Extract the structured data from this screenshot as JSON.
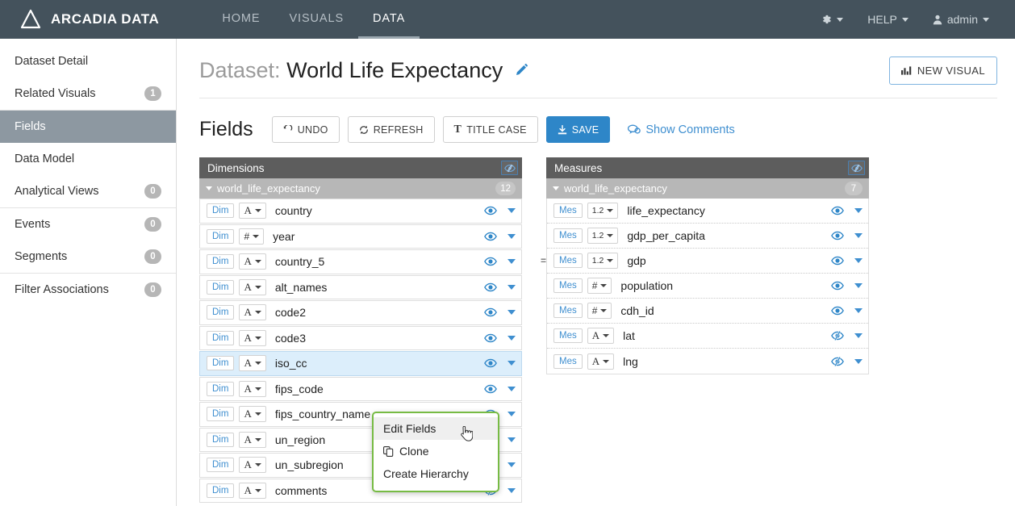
{
  "topnav": {
    "brand": "ARCADIA DATA",
    "logo_icon": "triangle-logo-icon",
    "links": [
      {
        "label": "HOME",
        "name": "nav-link-home",
        "active": false
      },
      {
        "label": "VISUALS",
        "name": "nav-link-visuals",
        "active": false
      },
      {
        "label": "DATA",
        "name": "nav-link-data",
        "active": true
      }
    ],
    "settings_icon": "gear-icon",
    "help_label": "HELP",
    "user_label": "admin",
    "user_icon": "user-icon"
  },
  "sidebar": {
    "groups": [
      {
        "items": [
          {
            "label": "Dataset Detail",
            "count": null,
            "active": false
          },
          {
            "label": "Related Visuals",
            "count": "1",
            "active": false
          }
        ]
      },
      {
        "items": [
          {
            "label": "Fields",
            "count": null,
            "active": true
          },
          {
            "label": "Data Model",
            "count": null,
            "active": false
          },
          {
            "label": "Analytical Views",
            "count": "0",
            "active": false
          }
        ]
      },
      {
        "items": [
          {
            "label": "Events",
            "count": "0",
            "active": false
          },
          {
            "label": "Segments",
            "count": "0",
            "active": false
          }
        ]
      },
      {
        "items": [
          {
            "label": "Filter Associations",
            "count": "0",
            "active": false
          }
        ]
      }
    ]
  },
  "page": {
    "title_prefix": "Dataset:",
    "title_name": "World Life Expectancy",
    "edit_icon": "pencil-icon",
    "new_visual_label": "NEW VISUAL",
    "new_visual_icon": "bar-chart-icon"
  },
  "toolbar": {
    "title": "Fields",
    "undo_label": "UNDO",
    "undo_icon": "undo-arrow-icon",
    "refresh_label": "REFRESH",
    "refresh_icon": "refresh-icon",
    "titlecase_label": "TITLE CASE",
    "titlecase_icon": "text-T-icon",
    "save_label": "SAVE",
    "save_icon": "download-save-icon",
    "comments_label": "Show Comments",
    "comments_icon": "speech-bubble-icon"
  },
  "dimensions_panel": {
    "header": "Dimensions",
    "header_eye_icon": "eye-slash-icon",
    "group_name": "world_life_expectancy",
    "group_count": "12",
    "fields": [
      {
        "tag": "Dim",
        "type": "A",
        "name": "country",
        "visible": true,
        "selected": false,
        "calculated": false
      },
      {
        "tag": "Dim",
        "type": "#",
        "name": "year",
        "visible": true,
        "selected": false,
        "calculated": false
      },
      {
        "tag": "Dim",
        "type": "A",
        "name": "country_5",
        "visible": true,
        "selected": false,
        "calculated": false
      },
      {
        "tag": "Dim",
        "type": "A",
        "name": "alt_names",
        "visible": true,
        "selected": false,
        "calculated": false
      },
      {
        "tag": "Dim",
        "type": "A",
        "name": "code2",
        "visible": true,
        "selected": false,
        "calculated": false
      },
      {
        "tag": "Dim",
        "type": "A",
        "name": "code3",
        "visible": true,
        "selected": false,
        "calculated": false
      },
      {
        "tag": "Dim",
        "type": "A",
        "name": "iso_cc",
        "visible": true,
        "selected": true,
        "calculated": false
      },
      {
        "tag": "Dim",
        "type": "A",
        "name": "fips_code",
        "visible": true,
        "selected": false,
        "calculated": false
      },
      {
        "tag": "Dim",
        "type": "A",
        "name": "fips_country_name",
        "visible": true,
        "selected": false,
        "calculated": false
      },
      {
        "tag": "Dim",
        "type": "A",
        "name": "un_region",
        "visible": true,
        "selected": false,
        "calculated": false
      },
      {
        "tag": "Dim",
        "type": "A",
        "name": "un_subregion",
        "visible": true,
        "selected": false,
        "calculated": false
      },
      {
        "tag": "Dim",
        "type": "A",
        "name": "comments",
        "visible": false,
        "selected": false,
        "calculated": false
      }
    ]
  },
  "measures_panel": {
    "header": "Measures",
    "header_eye_icon": "eye-slash-icon",
    "group_name": "world_life_expectancy",
    "group_count": "7",
    "fields": [
      {
        "tag": "Mes",
        "type": "1.2",
        "name": "life_expectancy",
        "visible": true,
        "selected": false,
        "calculated": false
      },
      {
        "tag": "Mes",
        "type": "1.2",
        "name": "gdp_per_capita",
        "visible": true,
        "selected": false,
        "calculated": false
      },
      {
        "tag": "Mes",
        "type": "1.2",
        "name": "gdp",
        "visible": true,
        "selected": false,
        "calculated": true
      },
      {
        "tag": "Mes",
        "type": "#",
        "name": "population",
        "visible": true,
        "selected": false,
        "calculated": false
      },
      {
        "tag": "Mes",
        "type": "#",
        "name": "cdh_id",
        "visible": true,
        "selected": false,
        "calculated": false
      },
      {
        "tag": "Mes",
        "type": "A",
        "name": "lat",
        "visible": false,
        "selected": false,
        "calculated": false
      },
      {
        "tag": "Mes",
        "type": "A",
        "name": "lng",
        "visible": false,
        "selected": false,
        "calculated": false
      }
    ]
  },
  "context_menu": {
    "items": [
      {
        "label": "Edit Fields",
        "icon": null,
        "hover": true
      },
      {
        "label": "Clone",
        "icon": "copy-icon",
        "hover": false
      },
      {
        "label": "Create Hierarchy",
        "icon": null,
        "hover": false
      }
    ],
    "border_color": "#77bb44",
    "cursor_icon": "pointer-hand-cursor"
  },
  "colors": {
    "nav_bg": "#44525c",
    "accent_blue": "#2e86c8",
    "link_blue": "#3f8fd0",
    "panel_head": "#5d5d5d",
    "group_head": "#b7b7b7",
    "sidebar_active": "#8d98a1",
    "menu_green": "#77bb44",
    "row_selected": "#dceefb"
  }
}
